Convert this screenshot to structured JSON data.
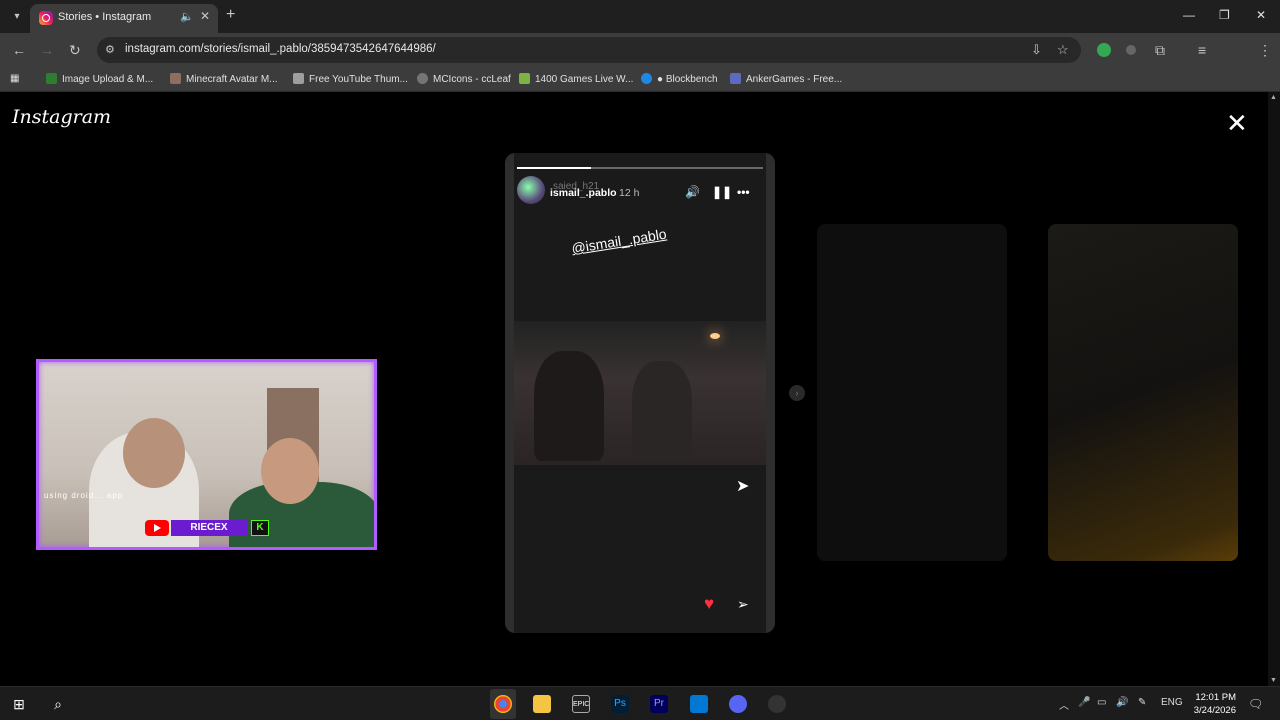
{
  "browser": {
    "tab_title": "Stories • Instagram",
    "new_tab": "+",
    "url": "instagram.com/stories/ismail_.pablo/3859473542647644986/",
    "profile_initial": "Y",
    "bookmarks": [
      {
        "label": "Image Upload & M...",
        "color": "#2e7d32"
      },
      {
        "label": "Minecraft Avatar M...",
        "color": "#8d6e63"
      },
      {
        "label": "Free YouTube Thum...",
        "color": "#9e9e9e"
      },
      {
        "label": "MCIcons - ccLeaf",
        "color": "#757575"
      },
      {
        "label": "1400 Games Live W...",
        "color": "#7cb342"
      },
      {
        "label": "● Blockbench",
        "color": "#1e88e5"
      },
      {
        "label": "AnkerGames - Free...",
        "color": "#5c6bc0"
      }
    ]
  },
  "page": {
    "logo": "Instagram",
    "close": "✕"
  },
  "story": {
    "username": "ismail_.pablo",
    "ghost_username": "saied_h21",
    "time": "12 h",
    "mention": "@ismail_.pablo",
    "progress": 0.3
  },
  "webcam": {
    "caption": "using droid... app",
    "channel_tag": "RIECEX",
    "kick": "K",
    "frame_color": "#b05cff"
  },
  "taskbar": {
    "language": "ENG",
    "time": "12:01 PM",
    "date": "3/24/2026"
  }
}
